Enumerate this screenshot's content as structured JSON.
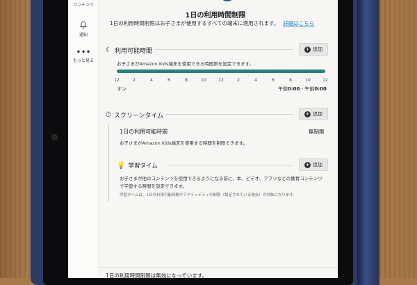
{
  "sidebar": {
    "items": [
      {
        "label": "コンテンツ",
        "icon": "content-icon"
      },
      {
        "label": "通知",
        "icon": "bell-icon"
      },
      {
        "label": "もっと見る",
        "icon": "more-dots-icon"
      }
    ]
  },
  "header": {
    "title": "1日の利用時間制限",
    "subtitle": "1日の利用時間制限はお子さまが使用するすべての端末に適用されます。",
    "link": "詳細はこちら"
  },
  "available_time": {
    "title": "利用可能時間",
    "add_label": "追加",
    "description": "お子さまがAmazon Kids端末を使用できる時間帯を設定できます。",
    "ticks": [
      "12",
      "2",
      "4",
      "6",
      "8",
      "10",
      "12",
      "2",
      "4",
      "6",
      "8",
      "10",
      "12"
    ],
    "status": "オン",
    "range_prefix_start": "午前",
    "range_start": "0:00",
    "range_sep": " - ",
    "range_prefix_end": "午前",
    "range_end": "0:00",
    "bar_color": "#2a7f82"
  },
  "screen_time": {
    "title": "スクリーンタイム",
    "add_label": "追加",
    "daily_title": "1日の利用可能時間",
    "daily_value": "無制限",
    "daily_desc": "お子さまがAmazon Kids端末を使用する時間を制限できます。"
  },
  "learning_time": {
    "title": "学習タイム",
    "add_label": "追加",
    "desc_line1": "お子さまが他のコンテンツを使用できるようになる前に、本、ビデオ、アプリなどの教育コンテンツ",
    "desc_line2": "で学習する時間を設定できます。",
    "note": "学習タイムは、1日の利用可能時間やアクティビティの制限（設定されている場合）の対象になります。"
  },
  "footer": {
    "text": "1日の利用時間制限は無効になっています。"
  }
}
